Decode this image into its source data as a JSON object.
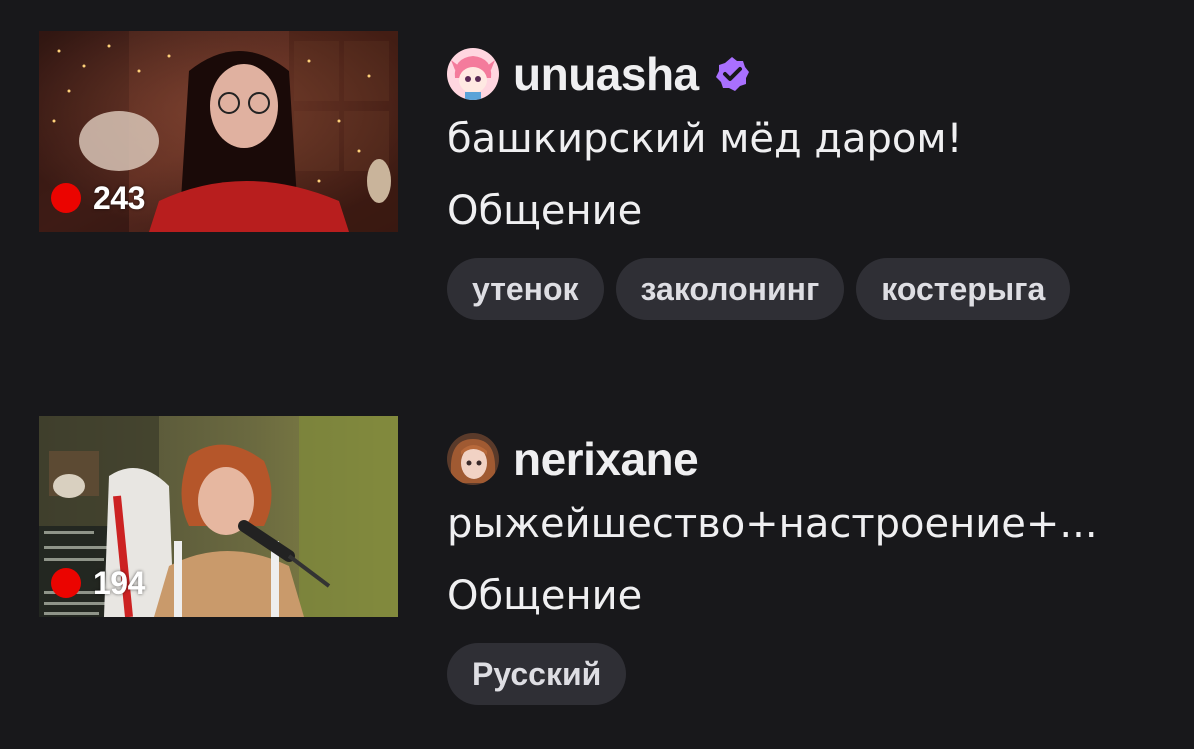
{
  "streams": [
    {
      "viewer_count": "243",
      "channel_name": "unuasha",
      "verified": true,
      "title": "башкирский мёд даром!",
      "category": "Общение",
      "tags": [
        "утенок",
        "заколонинг",
        "костерыга"
      ]
    },
    {
      "viewer_count": "194",
      "channel_name": "nerixane",
      "verified": false,
      "title": "рыжейшество+настроение+...",
      "category": "Общение",
      "tags": [
        "Русский"
      ]
    }
  ],
  "colors": {
    "background": "#18181b",
    "text": "#efeff1",
    "live": "#eb0400",
    "tag_bg": "#2f2f35",
    "verified": "#a970ff"
  },
  "icons": {
    "live": "live-indicator-icon",
    "verified": "verified-badge-icon"
  }
}
